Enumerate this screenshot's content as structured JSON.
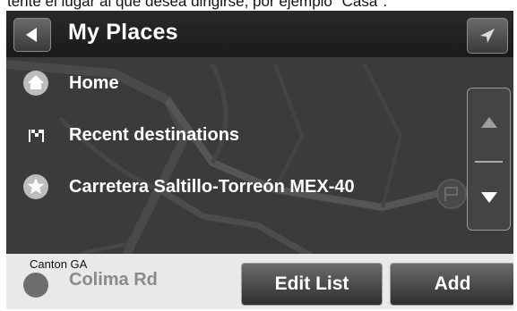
{
  "document_strip": {
    "text": "tente el lugar al que desea dirigirse, por ejemplo \"Casa\"."
  },
  "header": {
    "title": "My Places",
    "back_icon": "back-arrow-icon",
    "nav_icon": "navigate-arrow-icon"
  },
  "places": [
    {
      "label": "Home",
      "icon": "home-icon"
    },
    {
      "label": "Recent destinations",
      "icon": "checkered-flag-icon"
    },
    {
      "label": "Carretera Saltillo-Torreón MEX-40",
      "icon": "star-icon"
    },
    {
      "label": "Colima Rd",
      "icon": "place-icon"
    }
  ],
  "map": {
    "place_label": "Canton GA"
  },
  "footer": {
    "edit_label": "Edit List",
    "add_label": "Add"
  },
  "scrollbar": {
    "up_icon": "scroll-up-icon",
    "down_icon": "scroll-down-icon"
  }
}
